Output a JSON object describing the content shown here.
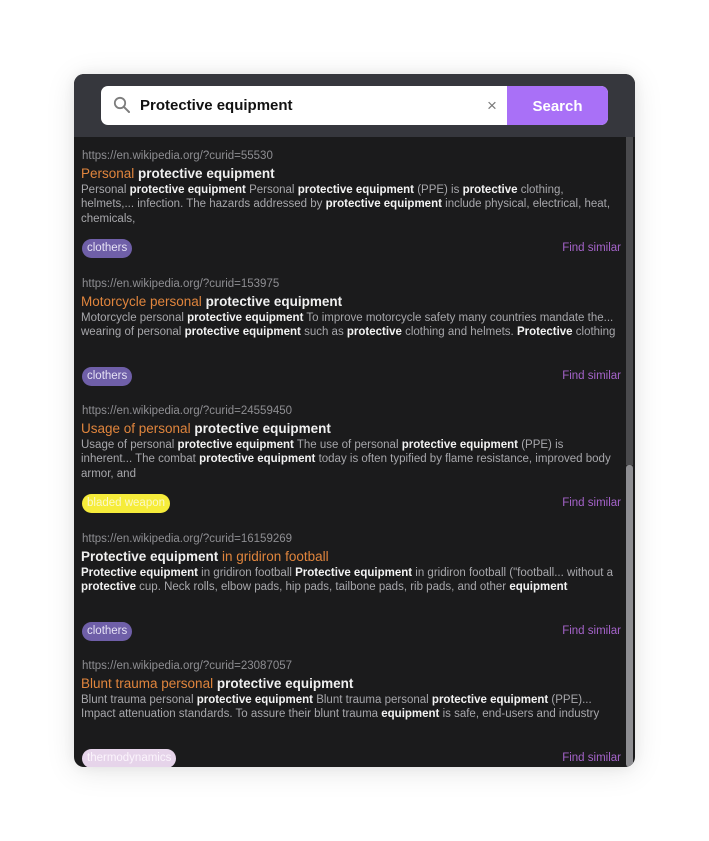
{
  "search": {
    "query": "Protective equipment",
    "clear_label": "×",
    "button_label": "Search"
  },
  "colors": {
    "accent": "#a970f7",
    "title_highlight": "#e0853d",
    "find_similar": "#a463c9"
  },
  "scroll": {
    "position_fraction": 0.52,
    "visible_fraction": 0.48
  },
  "results": [
    {
      "url": "https://en.wikipedia.org/?curid=55530",
      "title_parts": [
        {
          "text": "Personal ",
          "highlight": true
        },
        {
          "text": "protective equipment",
          "highlight": false
        }
      ],
      "snippet_parts": [
        {
          "text": "Personal ",
          "bold": false
        },
        {
          "text": "protective equipment",
          "bold": true
        },
        {
          "text": " Personal ",
          "bold": false
        },
        {
          "text": "protective equipment",
          "bold": true
        },
        {
          "text": " (PPE) is ",
          "bold": false
        },
        {
          "text": "protective",
          "bold": true
        },
        {
          "text": " clothing, helmets,... infection. The hazards addressed by ",
          "bold": false
        },
        {
          "text": "protective equipment",
          "bold": true
        },
        {
          "text": " include physical, electrical, heat, chemicals,",
          "bold": false
        }
      ],
      "tag": {
        "label": "clothers",
        "bg": "#6f5fa8",
        "fg": "#e6e2f5"
      },
      "find_similar_label": "Find similar"
    },
    {
      "url": "https://en.wikipedia.org/?curid=153975",
      "title_parts": [
        {
          "text": "Motorcycle personal ",
          "highlight": true
        },
        {
          "text": "protective equipment",
          "highlight": false
        }
      ],
      "snippet_parts": [
        {
          "text": "Motorcycle personal ",
          "bold": false
        },
        {
          "text": "protective equipment",
          "bold": true
        },
        {
          "text": " To improve motorcycle safety many countries mandate the... wearing of personal ",
          "bold": false
        },
        {
          "text": "protective equipment",
          "bold": true
        },
        {
          "text": " such as ",
          "bold": false
        },
        {
          "text": "protective",
          "bold": true
        },
        {
          "text": " clothing and helmets. ",
          "bold": false
        },
        {
          "text": "Protective",
          "bold": true
        },
        {
          "text": " clothing",
          "bold": false
        }
      ],
      "tag": {
        "label": "clothers",
        "bg": "#6f5fa8",
        "fg": "#e6e2f5"
      },
      "find_similar_label": "Find similar"
    },
    {
      "url": "https://en.wikipedia.org/?curid=24559450",
      "title_parts": [
        {
          "text": "Usage of personal ",
          "highlight": true
        },
        {
          "text": "protective equipment",
          "highlight": false
        }
      ],
      "snippet_parts": [
        {
          "text": "Usage of personal ",
          "bold": false
        },
        {
          "text": "protective equipment",
          "bold": true
        },
        {
          "text": " The use of personal ",
          "bold": false
        },
        {
          "text": "protective equipment",
          "bold": true
        },
        {
          "text": " (PPE) is inherent... The combat ",
          "bold": false
        },
        {
          "text": "protective equipment",
          "bold": true
        },
        {
          "text": " today is often typified by flame resistance, improved body armor, and",
          "bold": false
        }
      ],
      "tag": {
        "label": "bladed weapon",
        "bg": "#f6ec3a",
        "fg": "#fbf8c8"
      },
      "find_similar_label": "Find similar"
    },
    {
      "url": "https://en.wikipedia.org/?curid=16159269",
      "title_parts": [
        {
          "text": "Protective equipment",
          "highlight": false
        },
        {
          "text": " in gridiron football",
          "highlight": true
        }
      ],
      "snippet_parts": [
        {
          "text": "Protective equipment",
          "bold": true
        },
        {
          "text": " in gridiron football ",
          "bold": false
        },
        {
          "text": "Protective equipment",
          "bold": true
        },
        {
          "text": " in gridiron football (\"football... without a ",
          "bold": false
        },
        {
          "text": "protective",
          "bold": true
        },
        {
          "text": " cup. Neck rolls, elbow pads, hip pads, tailbone pads, rib pads, and other ",
          "bold": false
        },
        {
          "text": "equipment",
          "bold": true
        }
      ],
      "tag": {
        "label": "clothers",
        "bg": "#6f5fa8",
        "fg": "#e6e2f5"
      },
      "find_similar_label": "Find similar"
    },
    {
      "url": "https://en.wikipedia.org/?curid=23087057",
      "title_parts": [
        {
          "text": "Blunt trauma personal ",
          "highlight": true
        },
        {
          "text": "protective equipment",
          "highlight": false
        }
      ],
      "snippet_parts": [
        {
          "text": "Blunt trauma personal ",
          "bold": false
        },
        {
          "text": "protective equipment",
          "bold": true
        },
        {
          "text": " Blunt trauma personal ",
          "bold": false
        },
        {
          "text": "protective equipment",
          "bold": true
        },
        {
          "text": " (PPE)... Impact attenuation standards. To assure their blunt trauma ",
          "bold": false
        },
        {
          "text": "equipment",
          "bold": true
        },
        {
          "text": " is safe, end-users and industry",
          "bold": false
        }
      ],
      "tag": {
        "label": "thermodynamics",
        "bg": "#e6d4ea",
        "fg": "#fbf4fc"
      },
      "find_similar_label": "Find similar"
    }
  ]
}
